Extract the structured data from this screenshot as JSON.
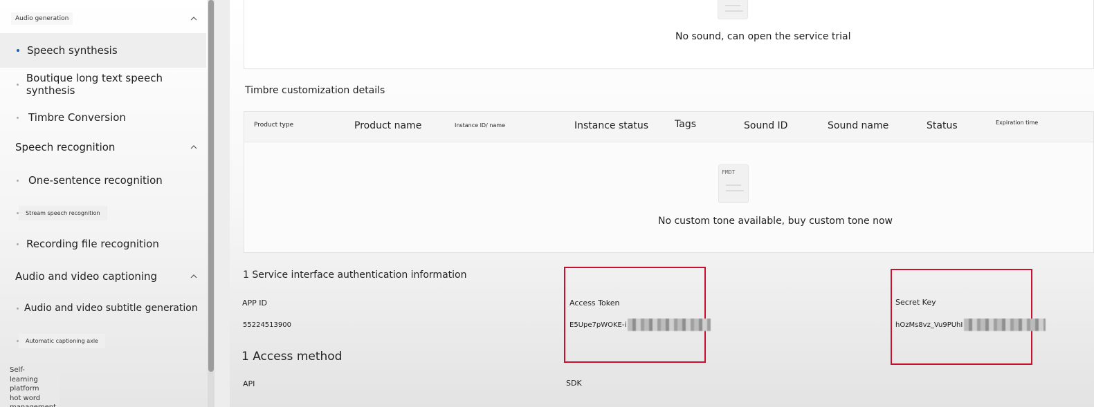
{
  "sidebar": {
    "groups": [
      {
        "label": "Audio generation",
        "tiny": true
      },
      {
        "label": "Speech recognition",
        "tiny": false
      },
      {
        "label": "Audio and video captioning",
        "tiny": false
      }
    ],
    "items": [
      {
        "label": "Speech synthesis"
      },
      {
        "label": "Boutique long text speech synthesis"
      },
      {
        "label": "Timbre Conversion"
      },
      {
        "label": "One-sentence recognition"
      },
      {
        "label": "Stream speech recognition"
      },
      {
        "label": "Recording file recognition"
      },
      {
        "label": "Audio and video subtitle generation"
      },
      {
        "label": "Automatic captioning axle"
      }
    ],
    "footer": "Self-learning platform hot word management"
  },
  "main": {
    "trial_empty_text": "No sound, can open the service trial",
    "timbre_section_title": "Timbre customization details",
    "table": {
      "columns": [
        "Product type",
        "Product name",
        "Instance ID/ name",
        "Instance status",
        "Tags",
        "Sound ID",
        "Sound name",
        "Status",
        "Expiration time"
      ],
      "empty_icon_code": "FMDT",
      "empty_text": "No custom tone available, buy custom tone now"
    },
    "auth": {
      "title": "1 Service interface authentication information",
      "app_id_label": "APP ID",
      "app_id_value": "55224513900",
      "access_token_label": "Access Token",
      "access_token_value": "E5Upe7pWOKE-i",
      "secret_key_label": "Secret Key",
      "secret_key_value": "hOzMs8vz_Vu9PUhI"
    },
    "access": {
      "title": "1 Access method",
      "api_label": "API",
      "sdk_label": "SDK"
    }
  },
  "colors": {
    "active_dot": "#1a5fb4",
    "highlight_box": "#c8102e"
  }
}
